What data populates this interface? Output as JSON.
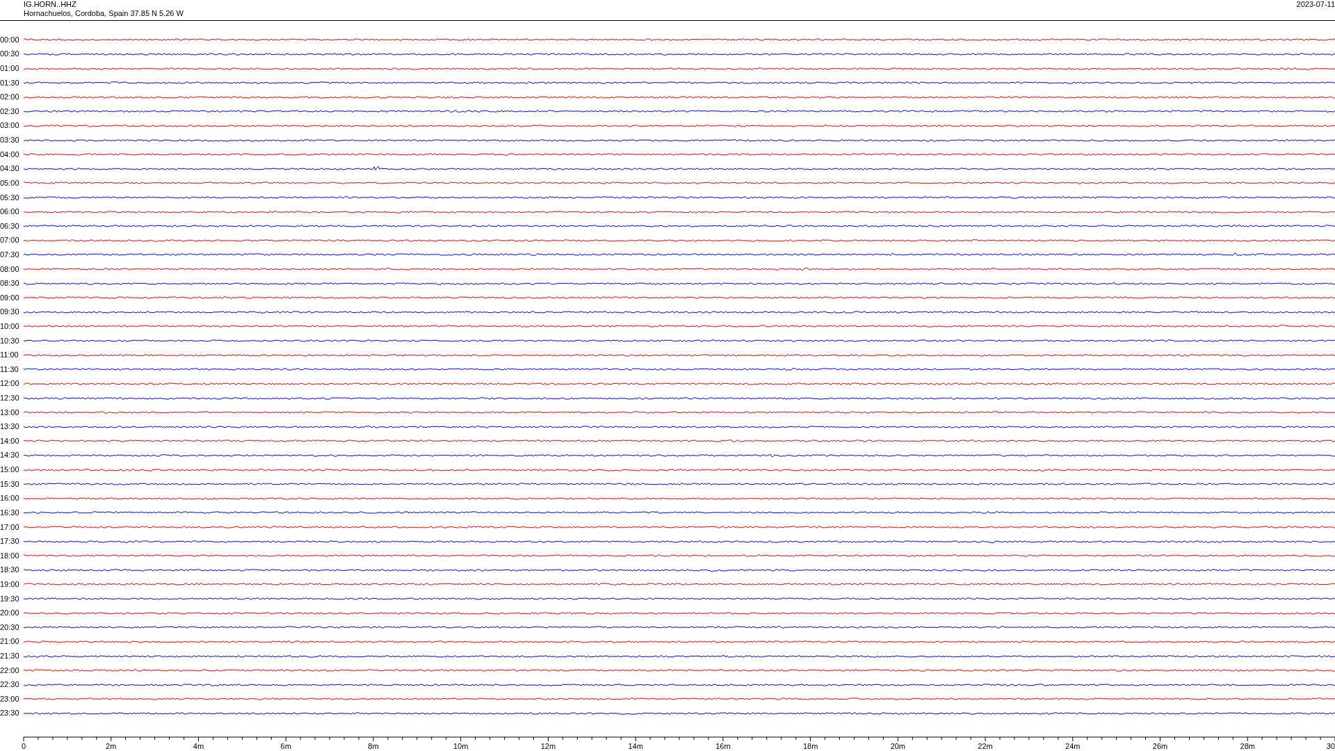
{
  "header": {
    "station": "IG.HORN..HHZ",
    "location": "Hornachuelos, Cordoba, Spain  37.85 N 5.26 W",
    "date": "2023-07-11"
  },
  "traces": [
    {
      "time": "00:00",
      "color": "#ff0000"
    },
    {
      "time": "00:30",
      "color": "#0000ff"
    },
    {
      "time": "01:00",
      "color": "#ff0000"
    },
    {
      "time": "01:30",
      "color": "#0000ff"
    },
    {
      "time": "02:00",
      "color": "#ff0000"
    },
    {
      "time": "02:30",
      "color": "#0000ff"
    },
    {
      "time": "03:00",
      "color": "#ff0000"
    },
    {
      "time": "03:30",
      "color": "#0000ff"
    },
    {
      "time": "04:00",
      "color": "#ff0000"
    },
    {
      "time": "04:30",
      "color": "#0000ff"
    },
    {
      "time": "05:00",
      "color": "#ff0000"
    },
    {
      "time": "05:30",
      "color": "#0000ff"
    },
    {
      "time": "06:00",
      "color": "#ff0000"
    },
    {
      "time": "06:30",
      "color": "#0000ff"
    },
    {
      "time": "07:00",
      "color": "#ff0000"
    },
    {
      "time": "07:30",
      "color": "#0000ff"
    },
    {
      "time": "08:00",
      "color": "#ff0000"
    },
    {
      "time": "08:30",
      "color": "#0000ff"
    },
    {
      "time": "09:00",
      "color": "#ff0000"
    },
    {
      "time": "09:30",
      "color": "#0000ff"
    },
    {
      "time": "10:00",
      "color": "#ff0000"
    },
    {
      "time": "10:30",
      "color": "#0000ff"
    },
    {
      "time": "11:00",
      "color": "#ff0000"
    },
    {
      "time": "11:30",
      "color": "#0000ff"
    },
    {
      "time": "12:00",
      "color": "#ff0000"
    },
    {
      "time": "12:30",
      "color": "#0000ff"
    },
    {
      "time": "13:00",
      "color": "#ff0000"
    },
    {
      "time": "13:30",
      "color": "#0000ff"
    },
    {
      "time": "14:00",
      "color": "#ff0000"
    },
    {
      "time": "14:30",
      "color": "#0000ff"
    },
    {
      "time": "15:00",
      "color": "#ff0000"
    },
    {
      "time": "15:30",
      "color": "#0000ff"
    },
    {
      "time": "16:00",
      "color": "#ff0000"
    },
    {
      "time": "16:30",
      "color": "#0000ff"
    },
    {
      "time": "17:00",
      "color": "#ff0000"
    },
    {
      "time": "17:30",
      "color": "#0000ff"
    },
    {
      "time": "18:00",
      "color": "#ff0000"
    },
    {
      "time": "18:30",
      "color": "#0000ff"
    },
    {
      "time": "19:00",
      "color": "#ff0000"
    },
    {
      "time": "19:30",
      "color": "#0000ff"
    },
    {
      "time": "20:00",
      "color": "#ff0000"
    },
    {
      "time": "20:30",
      "color": "#0000ff"
    },
    {
      "time": "21:00",
      "color": "#ff0000"
    },
    {
      "time": "21:30",
      "color": "#0000ff"
    },
    {
      "time": "22:00",
      "color": "#ff0000"
    },
    {
      "time": "22:30",
      "color": "#0000ff"
    },
    {
      "time": "23:00",
      "color": "#ff0000"
    },
    {
      "time": "23:30",
      "color": "#0000ff"
    }
  ],
  "x_axis": {
    "labels": [
      "0",
      "2m",
      "4m",
      "6m",
      "8m",
      "10m",
      "12m",
      "14m",
      "16m",
      "18m",
      "20m",
      "22m",
      "24m",
      "26m",
      "28m",
      "30"
    ]
  }
}
